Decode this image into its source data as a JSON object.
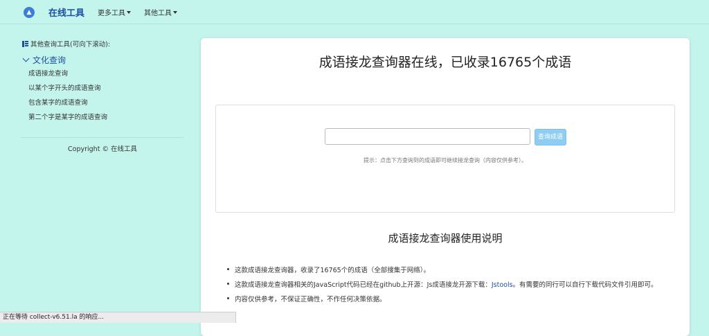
{
  "navbar": {
    "brand_logo": "chart-logo-icon",
    "brand": "在线工具",
    "menu1": "更多工具",
    "menu2": "其他工具"
  },
  "sidebar": {
    "title": "其他查询工具(可向下滚动):",
    "category": "文化查询",
    "items": [
      {
        "label": "成语接龙查询"
      },
      {
        "label": "以某个字开头的成语查询"
      },
      {
        "label": "包含某字的成语查询"
      },
      {
        "label": "第二个字是某字的成语查询"
      }
    ],
    "copyright": "Copyright © 在线工具"
  },
  "main": {
    "title": "成语接龙查询器在线，已收录16765个成语",
    "search": {
      "value": "",
      "placeholder": "",
      "button": "查询成语",
      "hint": "提示：点击下方查询到的成语即可继续接龙查询（内容仅供参考）。"
    },
    "section_title": "成语接龙查询器使用说明",
    "notes": {
      "n1": "这款成语接龙查询器，收录了16765个的成语（全部搜集于网络）。",
      "n2_pre": "这款成语接龙查询器相关的JavaScript代码已经在github上开源：Js成语接龙开源下载：",
      "n2_link": "Jstools",
      "n2_post": "。有需要的同行可以自行下载代码文件引用即可。",
      "n3": "内容仅供参考，不保证正确性，不作任何决策依据。"
    }
  },
  "statusbar": {
    "text": "正在等待 collect-v6.51.la 的响应..."
  },
  "colors": {
    "background": "#c4f5ec",
    "accent": "#1d4ea3",
    "button": "#8ecdf1"
  }
}
